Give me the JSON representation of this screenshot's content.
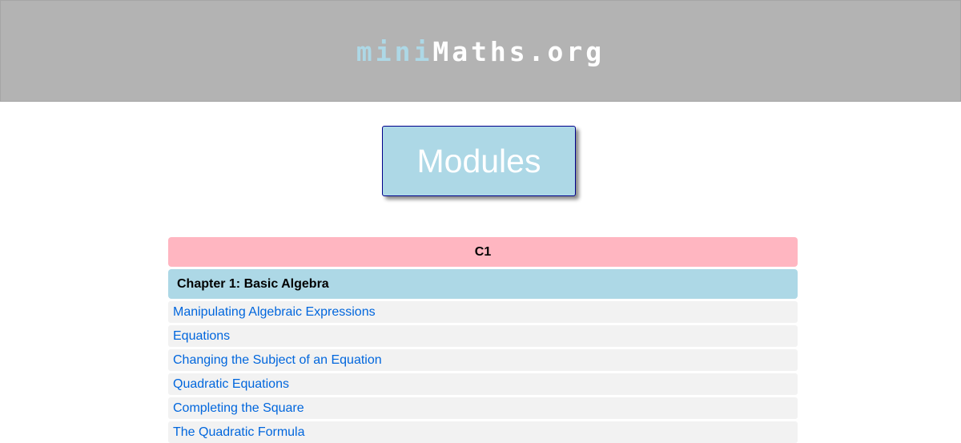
{
  "header": {
    "logo_part1": "mini",
    "logo_part2": "Maths.org"
  },
  "modules_button": {
    "label": "Modules"
  },
  "module": {
    "title": "C1",
    "chapter": "Chapter 1: Basic Algebra",
    "topics": [
      "Manipulating Algebraic Expressions",
      "Equations",
      "Changing the Subject of an Equation",
      "Quadratic Equations",
      "Completing the Square",
      "The Quadratic Formula"
    ]
  },
  "colors": {
    "header_bg": "#b3b3b3",
    "logo_accent": "#add8e6",
    "module_header_bg": "#ffb6c1",
    "chapter_bg": "#add8e6",
    "link": "#0066dd"
  }
}
